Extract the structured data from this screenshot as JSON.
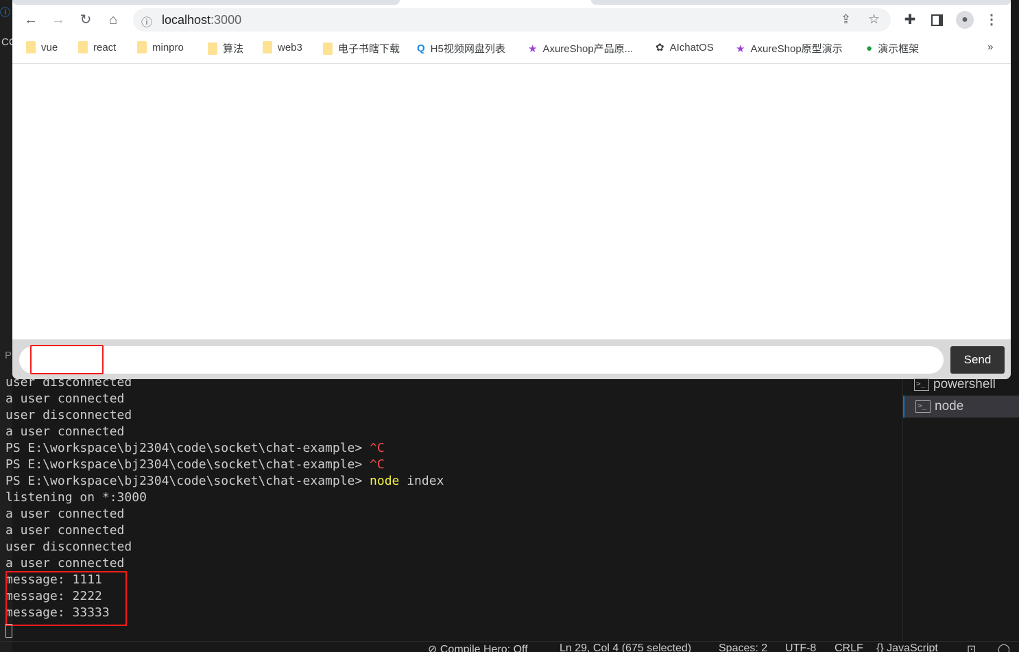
{
  "browser": {
    "url_host": "localhost",
    "url_port": ":3000",
    "bookmarks": [
      {
        "label": "vue",
        "icon": "folder-icon"
      },
      {
        "label": "react",
        "icon": "folder-icon"
      },
      {
        "label": "minpro",
        "icon": "folder-icon"
      },
      {
        "label": "算法",
        "icon": "folder-icon"
      },
      {
        "label": "web3",
        "icon": "folder-icon"
      },
      {
        "label": "电子书瞎下载",
        "icon": "folder-icon"
      },
      {
        "label": "H5视频网盘列表",
        "icon": "site-icon"
      },
      {
        "label": "AxureShop产品原...",
        "icon": "star-icon"
      },
      {
        "label": "AIchatOS",
        "icon": "openai-icon"
      },
      {
        "label": "AxureShop原型演示",
        "icon": "star-icon"
      },
      {
        "label": "演示框架",
        "icon": "site-icon"
      }
    ],
    "more": "»"
  },
  "page": {
    "input_value": "",
    "send_label": "Send"
  },
  "terminal": {
    "prompt": "PS E:\\workspace\\bj2304\\code\\socket\\chat-example>",
    "lines": [
      "user disconnected",
      "a user connected",
      "user disconnected",
      "a user connected"
    ],
    "ctrlc": "^C",
    "cmd": "node",
    "cmd_arg": "index",
    "after": [
      "listening on *:3000",
      "a user connected",
      "a user connected",
      "user disconnected",
      "a user connected",
      "message: 1111",
      "message: 2222",
      "message: 33333"
    ]
  },
  "panel": {
    "items": [
      "powershell",
      "node"
    ]
  },
  "statusbar": {
    "compile": "Compile Hero: Off",
    "position": "Ln 29, Col 4 (675 selected)",
    "spaces": "Spaces: 2",
    "encoding": "UTF-8",
    "eol": "CRLF",
    "language": "JavaScript"
  },
  "leftstrip": {
    "cc": "CC",
    "p": "P"
  }
}
